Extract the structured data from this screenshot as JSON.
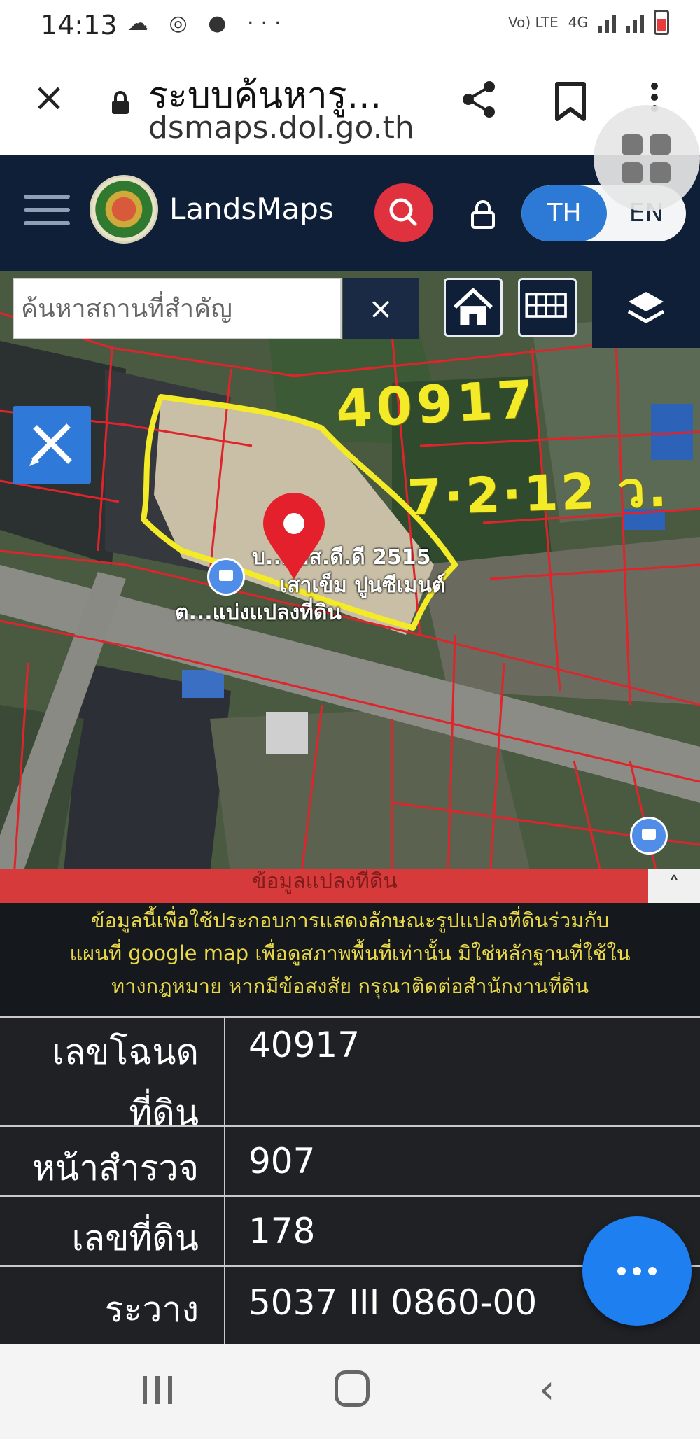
{
  "status_bar": {
    "time": "14:13",
    "icons": "☁ ◎ ● ···",
    "network_label": "Vo) LTE",
    "network_type": "4G"
  },
  "browser": {
    "page_title": "ระบบค้นหารู...",
    "domain": "dsmaps.dol.go.th"
  },
  "app_header": {
    "brand": "LandsMaps",
    "lang_th": "TH",
    "lang_en": "EN"
  },
  "map": {
    "search_placeholder": "ค้นหาสถานที่สำคัญ",
    "clear_label": "×",
    "annotation_parcel": "40917",
    "annotation_area": "7·2·12 ว.",
    "place_label_1": "บ...เอส.ดี.ดี 2515",
    "place_label_2": "เสาเข็ม ปูนซีเมนต์",
    "place_label_3": "ต...แบ่งแปลงที่ดิน"
  },
  "info_panel": {
    "banner_text": "ข้อมูลแปลงที่ดิน",
    "disclaimer_lines": [
      "ข้อมูลนี้เพื่อใช้ประกอบการแสดงลักษณะรูปแปลงที่ดินร่วมกับ",
      "แผนที่ google map เพื่อดูสภาพพื้นที่เท่านั้น มิใช่หลักฐานที่ใช้ใน",
      "ทางกฎหมาย หากมีข้อสงสัย กรุณาติดต่อสำนักงานที่ดิน"
    ],
    "rows": [
      {
        "label_line1": "เลขโฉนด",
        "label_line2": "ที่ดิน",
        "value": "40917"
      },
      {
        "label": "หน้าสำรวจ",
        "value": "907"
      },
      {
        "label": "เลขที่ดิน",
        "value": "178"
      },
      {
        "label": "ระวาง",
        "value": "5037 III 0860-00"
      }
    ]
  },
  "colors": {
    "header_bg": "#0f1f38",
    "accent_red": "#e0313f",
    "accent_blue": "#2d7ad6",
    "annotation_yellow": "#f3ea28",
    "parcel_line": "#e0242b"
  },
  "icons": [
    "close-icon",
    "lock-icon",
    "share-icon",
    "bookmark-icon",
    "more-vert-icon",
    "tabs-grid-icon",
    "hamburger-icon",
    "seal-logo-icon",
    "search-icon",
    "padlock-icon",
    "home-icon",
    "grid-icon",
    "layers-icon",
    "pencil-ruler-icon",
    "map-pin-icon",
    "poi-icon",
    "more-horiz-icon",
    "recents-icon",
    "nav-home-icon",
    "back-icon"
  ]
}
